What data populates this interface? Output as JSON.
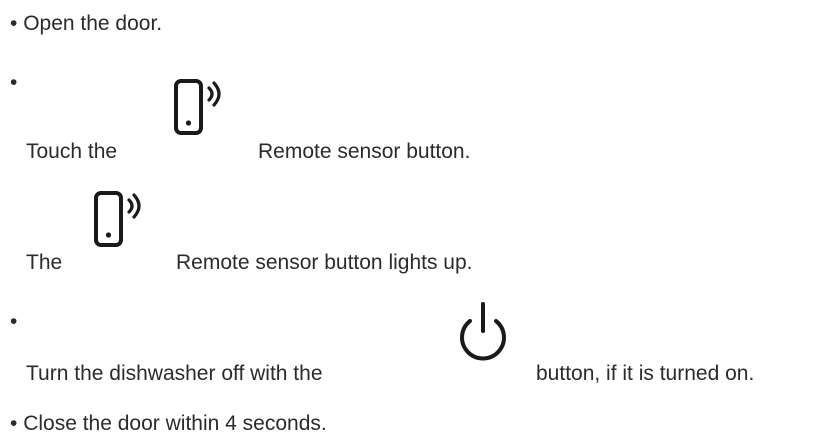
{
  "steps": {
    "step1": {
      "bullet": "•",
      "text": "Open the door."
    },
    "step2": {
      "bullet": "•",
      "line1_prefix": "Touch the",
      "line1_suffix": "Remote sensor button.",
      "line2_prefix": "The",
      "line2_suffix": "Remote sensor button lights up.",
      "icon": "remote-sensor-icon"
    },
    "step3": {
      "bullet": "•",
      "text_prefix": "Turn the dishwasher off with the",
      "text_suffix": "button, if it is turned on.",
      "icon": "power-icon"
    },
    "step4": {
      "bullet": "•",
      "text": "Close the door within 4 seconds."
    }
  },
  "colors": {
    "text": "#2b2b2b",
    "icon": "#1a1a1a"
  }
}
